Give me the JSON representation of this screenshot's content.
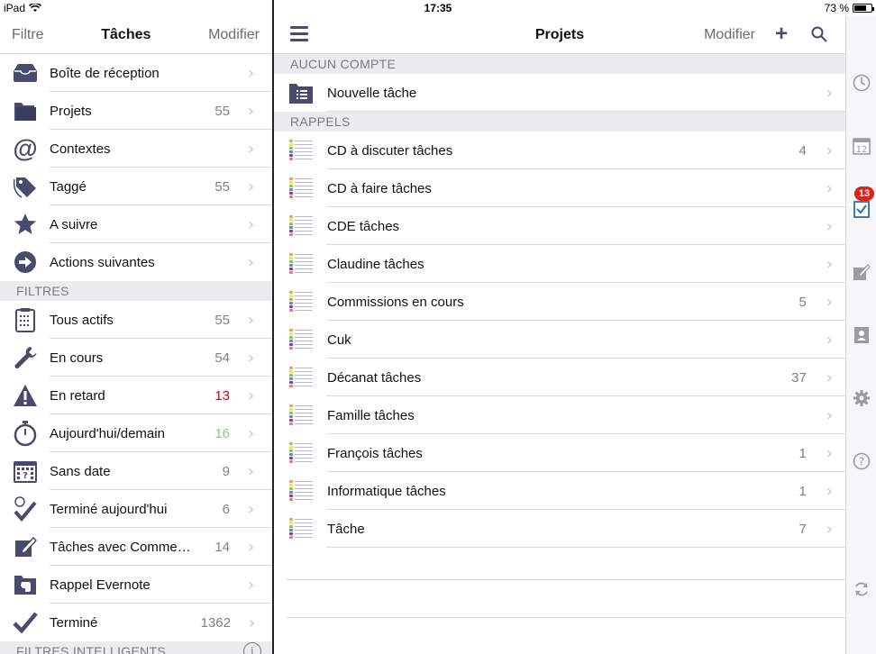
{
  "status": {
    "device": "iPad",
    "time": "17:35",
    "battery": "73 %",
    "battery_level": 0.73
  },
  "left": {
    "nav": {
      "left": "Filtre",
      "title": "Tâches",
      "right": "Modifier"
    },
    "items": [
      {
        "label": "Boîte de réception",
        "count": "",
        "icon": "inbox-icon"
      },
      {
        "label": "Projets",
        "count": "55",
        "icon": "folder-icon"
      },
      {
        "label": "Contextes",
        "count": "",
        "icon": "at-icon"
      },
      {
        "label": "Taggé",
        "count": "55",
        "icon": "tag-icon"
      },
      {
        "label": "A suivre",
        "count": "",
        "icon": "star-icon"
      },
      {
        "label": "Actions suivantes",
        "count": "",
        "icon": "arrow-circle-icon"
      }
    ],
    "filters_header": "FILTRES",
    "filters": [
      {
        "label": "Tous actifs",
        "count": "55",
        "icon": "clipboard-icon",
        "color": "#808080"
      },
      {
        "label": "En cours",
        "count": "54",
        "icon": "wrench-icon",
        "color": "#808080"
      },
      {
        "label": "En retard",
        "count": "13",
        "icon": "warning-icon",
        "color": "#d0021b"
      },
      {
        "label": "Aujourd'hui/demain",
        "count": "16",
        "icon": "stopwatch-icon",
        "color": "#7ed27e"
      },
      {
        "label": "Sans date",
        "count": "9",
        "icon": "calendar-icon",
        "color": "#808080"
      },
      {
        "label": "Terminé aujourd'hui",
        "count": "6",
        "icon": "check-timer-icon",
        "color": "#808080"
      },
      {
        "label": "Tâches avec Comme…",
        "count": "14",
        "icon": "note-edit-icon",
        "color": "#808080"
      },
      {
        "label": "Rappel Evernote",
        "count": "",
        "icon": "evernote-icon",
        "color": "#808080"
      },
      {
        "label": "Terminé",
        "count": "1362",
        "icon": "checkmark-icon",
        "color": "#808080"
      }
    ],
    "smart_header": "FILTRES INTELLIGENTS",
    "info_glyph": "i"
  },
  "main": {
    "nav": {
      "title": "Projets",
      "edit": "Modifier",
      "plus": "+"
    },
    "no_account_header": "AUCUN COMPTE",
    "new_task": "Nouvelle tâche",
    "reminders_header": "RAPPELS",
    "lists": [
      {
        "label": "CD à discuter tâches",
        "count": "4"
      },
      {
        "label": "CD à faire tâches",
        "count": ""
      },
      {
        "label": "CDE tâches",
        "count": ""
      },
      {
        "label": "Claudine tâches",
        "count": ""
      },
      {
        "label": "Commissions en cours",
        "count": "5"
      },
      {
        "label": "Cuk",
        "count": ""
      },
      {
        "label": "Décanat tâches",
        "count": "37"
      },
      {
        "label": "Famille tâches",
        "count": ""
      },
      {
        "label": "François tâches",
        "count": "1"
      },
      {
        "label": "Informatique tâches",
        "count": "1"
      },
      {
        "label": "Tâche",
        "count": "7"
      }
    ]
  },
  "rail": {
    "badge": "13",
    "calendar_day": "12"
  },
  "colors": {
    "accent": "#4a4a6e",
    "overdue": "#d0021b",
    "today": "#7ed27e",
    "badge": "#e0201b"
  }
}
